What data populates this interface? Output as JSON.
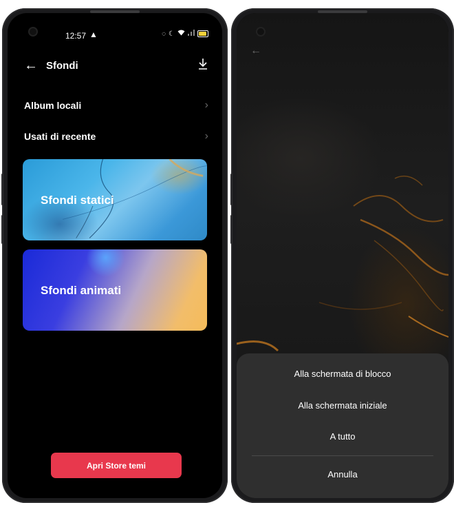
{
  "left_screen": {
    "status": {
      "time": "12:57",
      "warning_icon": "warning-icon",
      "icons": [
        "alarm-icon",
        "moon-icon",
        "wifi-icon",
        "signal-icon",
        "battery-icon"
      ]
    },
    "header": {
      "back_icon": "back-arrow-icon",
      "title": "Sfondi",
      "download_icon": "download-icon"
    },
    "rows": [
      {
        "label": "Album locali"
      },
      {
        "label": "Usati di recente"
      }
    ],
    "cards": [
      {
        "label": "Sfondi statici"
      },
      {
        "label": "Sfondi animati"
      }
    ],
    "store_button": "Apri Store temi",
    "colors": {
      "accent": "#e8384d",
      "battery": "#f2d23a"
    }
  },
  "right_screen": {
    "back_icon": "back-arrow-icon",
    "sheet": {
      "options": [
        "Alla schermata di blocco",
        "Alla schermata iniziale",
        "A tutto"
      ],
      "cancel": "Annulla"
    }
  }
}
